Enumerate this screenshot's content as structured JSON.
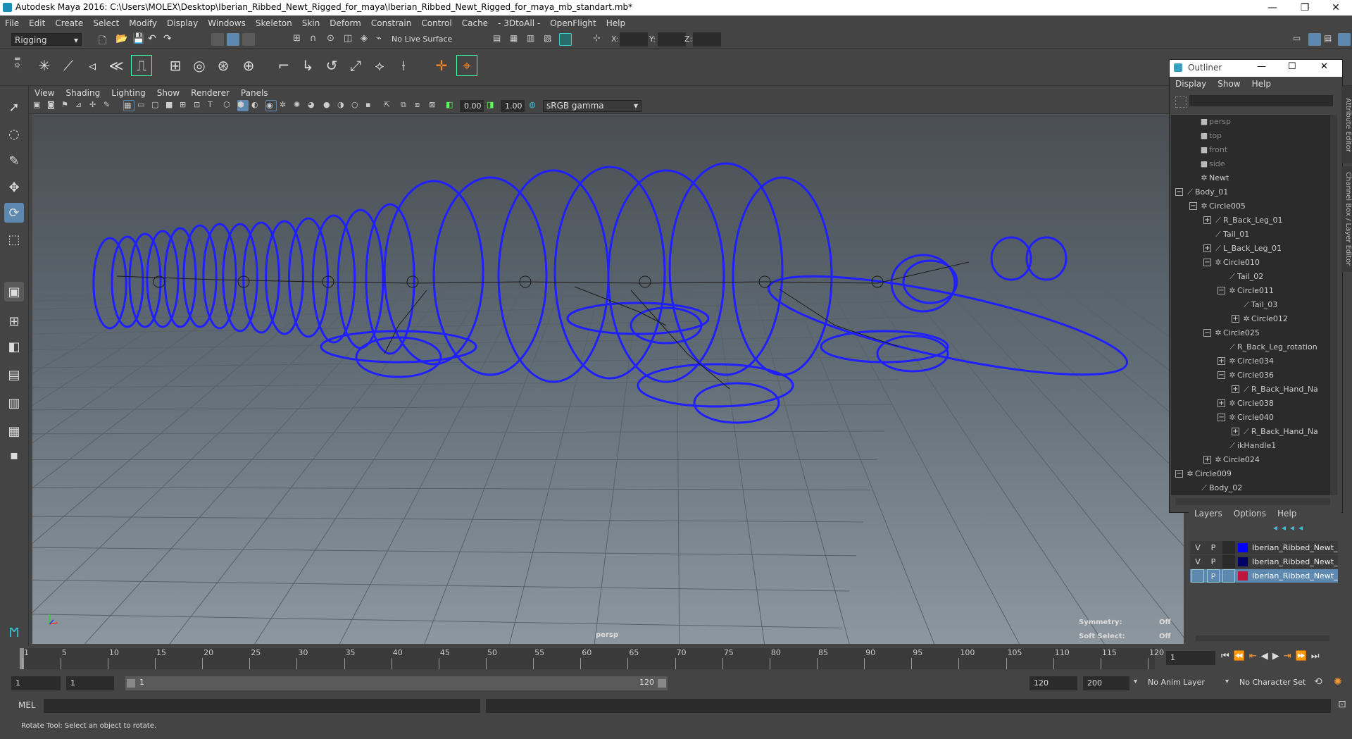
{
  "window": {
    "title": "Autodesk Maya 2016: C:\\Users\\MOLEX\\Desktop\\Iberian_Ribbed_Newt_Rigged_for_maya\\Iberian_Ribbed_Newt_Rigged_for_maya_mb_standart.mb*",
    "minimize": "—",
    "restore": "❐",
    "close": "✕"
  },
  "menu": [
    "File",
    "Edit",
    "Create",
    "Select",
    "Modify",
    "Display",
    "Windows",
    "Skeleton",
    "Skin",
    "Deform",
    "Constrain",
    "Control",
    "Cache",
    "- 3DtoAll -",
    "OpenFlight",
    "Help"
  ],
  "status": {
    "mode": "Rigging",
    "live_surface": "No Live Surface",
    "x_label": "X:",
    "y_label": "Y:",
    "z_label": "Z:"
  },
  "panel_menu": [
    "View",
    "Shading",
    "Lighting",
    "Show",
    "Renderer",
    "Panels"
  ],
  "panel_toolbar": {
    "exposure": "0.00",
    "gamma": "1.00",
    "color_space": "sRGB gamma"
  },
  "viewport": {
    "camera": "persp",
    "symmetry_label": "Symmetry:",
    "symmetry_value": "Off",
    "soft_select_label": "Soft Select:",
    "soft_select_value": "Off",
    "wire_color": "#1f1fff"
  },
  "outliner": {
    "title": "Outliner",
    "menu": [
      "Display",
      "Show",
      "Help"
    ],
    "items": [
      {
        "label": "persp",
        "icon": "camera-icon",
        "exp": ""
      },
      {
        "label": "top",
        "icon": "camera-icon",
        "exp": ""
      },
      {
        "label": "front",
        "icon": "camera-icon",
        "exp": ""
      },
      {
        "label": "side",
        "icon": "camera-icon",
        "exp": ""
      },
      {
        "label": "Newt",
        "icon": "transform-icon",
        "exp": ""
      },
      {
        "label": "Body_01",
        "icon": "joint-icon",
        "exp": "−"
      },
      {
        "label": "Circle005",
        "icon": "transform-icon",
        "exp": "−"
      },
      {
        "label": "R_Back_Leg_01",
        "icon": "joint-icon",
        "exp": "+"
      },
      {
        "label": "Tail_01",
        "icon": "joint-icon",
        "exp": ""
      },
      {
        "label": "L_Back_Leg_01",
        "icon": "joint-icon",
        "exp": "+"
      },
      {
        "label": "Circle010",
        "icon": "transform-icon",
        "exp": "−"
      },
      {
        "label": "Tail_02",
        "icon": "joint-icon",
        "exp": ""
      },
      {
        "label": "Circle011",
        "icon": "transform-icon",
        "exp": "−"
      },
      {
        "label": "Tail_03",
        "icon": "joint-icon",
        "exp": ""
      },
      {
        "label": "Circle012",
        "icon": "transform-icon",
        "exp": "+"
      },
      {
        "label": "Circle025",
        "icon": "transform-icon",
        "exp": "−"
      },
      {
        "label": "R_Back_Leg_rotation",
        "icon": "joint-icon",
        "exp": ""
      },
      {
        "label": "Circle034",
        "icon": "transform-icon",
        "exp": "+"
      },
      {
        "label": "Circle036",
        "icon": "transform-icon",
        "exp": "−"
      },
      {
        "label": "R_Back_Hand_Na",
        "icon": "joint-icon",
        "exp": "+"
      },
      {
        "label": "Circle038",
        "icon": "transform-icon",
        "exp": "+"
      },
      {
        "label": "Circle040",
        "icon": "transform-icon",
        "exp": "−"
      },
      {
        "label": "R_Back_Hand_Na",
        "icon": "joint-icon",
        "exp": "+"
      },
      {
        "label": "ikHandle1",
        "icon": "ik-icon",
        "exp": ""
      },
      {
        "label": "Circle024",
        "icon": "transform-icon",
        "exp": "+"
      },
      {
        "label": "Circle009",
        "icon": "transform-icon",
        "exp": "−"
      },
      {
        "label": "Body_02",
        "icon": "joint-icon",
        "exp": ""
      }
    ]
  },
  "layers": {
    "menu": [
      "Layers",
      "Options",
      "Help"
    ],
    "rows": [
      {
        "v": "V",
        "p": "P",
        "name": "Iberian_Ribbed_Newt_",
        "color": "#0000ff",
        "selected": false
      },
      {
        "v": "V",
        "p": "P",
        "name": "Iberian_Ribbed_Newt_",
        "color": "#000066",
        "selected": false
      },
      {
        "v": "",
        "p": "P",
        "name": "Iberian_Ribbed_Newt_",
        "color": "#c0143c",
        "selected": true
      }
    ]
  },
  "side_tabs": [
    "Attribute Editor",
    "Channel Box / Layer Editor"
  ],
  "timeline": {
    "ticks": [
      "1",
      "5",
      "10",
      "15",
      "20",
      "25",
      "30",
      "35",
      "40",
      "45",
      "50",
      "55",
      "60",
      "65",
      "70",
      "75",
      "80",
      "85",
      "90",
      "95",
      "100",
      "105",
      "110",
      "115",
      "120"
    ],
    "current_frame": "1"
  },
  "range": {
    "start": "1",
    "playback_start": "1",
    "slider_start": "1",
    "slider_end": "120",
    "playback_end": "120",
    "end": "200",
    "anim_layer": "No Anim Layer",
    "character_set": "No Character Set"
  },
  "command": {
    "label": "MEL"
  },
  "help_line": "Rotate Tool: Select an object to rotate."
}
